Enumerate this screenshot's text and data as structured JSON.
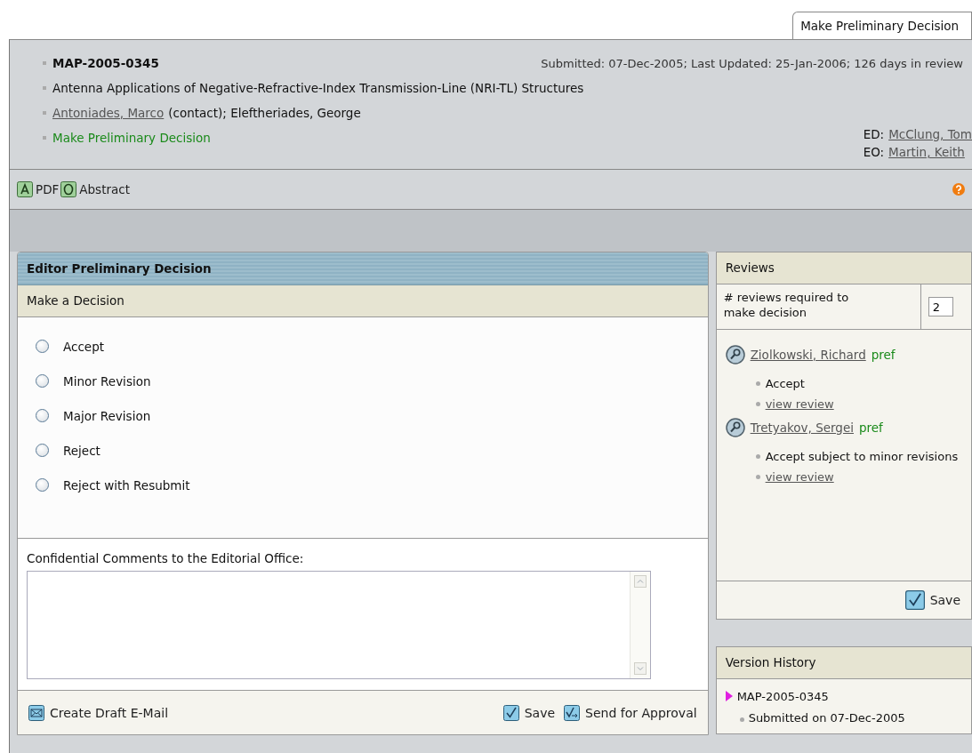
{
  "tab": {
    "label": "Make Preliminary Decision",
    "selected": true
  },
  "header": {
    "manuscript_id": "MAP-2005-0345",
    "dates": "Submitted: 07-Dec-2005; Last Updated: 25-Jan-2006; 126 days in review",
    "title": "Antenna Applications of Negative-Refractive-Index Transmission-Line (NRI-TL) Structures",
    "contact_author": "Antoniades, Marco",
    "authors_rest": "(contact); Eleftheriades, George",
    "stage": "Make Preliminary Decision",
    "staff": [
      {
        "role": "ED:",
        "name": "McClung, Tom"
      },
      {
        "role": "EO:",
        "name": "Martin, Keith"
      }
    ]
  },
  "toolbar": {
    "items": [
      {
        "kind": "pdf",
        "label": "PDF"
      },
      {
        "kind": "abstract",
        "label": "Abstract"
      }
    ]
  },
  "decision_panel": {
    "title": "Editor Preliminary Decision",
    "subtitle": "Make a Decision",
    "options": [
      {
        "label": "Accept",
        "selected": false
      },
      {
        "label": "Minor Revision",
        "selected": false
      },
      {
        "label": "Major Revision",
        "selected": false
      },
      {
        "label": "Reject",
        "selected": false
      },
      {
        "label": "Reject with Resubmit",
        "selected": false
      }
    ],
    "comments_label": "Confidential Comments to the Editorial Office:",
    "actions": [
      {
        "kind": "email",
        "label": "Create Draft E-Mail"
      },
      {
        "kind": "save",
        "label": "Save"
      },
      {
        "kind": "approve",
        "label": "Send for Approval"
      }
    ]
  },
  "reviews": {
    "title": "Reviews",
    "required_label": "# reviews required to make decision",
    "required_value": "2",
    "reviewers": [
      {
        "name": "Ziolkowski, Richard",
        "tag": "pref",
        "items": [
          {
            "kind": "text",
            "label": "Accept"
          },
          {
            "kind": "link",
            "label": "view review"
          }
        ]
      },
      {
        "name": "Tretyakov, Sergei",
        "tag": "pref",
        "items": [
          {
            "kind": "text",
            "label": "Accept subject to minor revisions"
          },
          {
            "kind": "link",
            "label": "view review"
          }
        ]
      }
    ],
    "save": "Save"
  },
  "version_history": {
    "title": "Version History",
    "versions": [
      {
        "id": "MAP-2005-0345",
        "events": [
          "Submitted on 07-Dec-2005"
        ]
      }
    ]
  }
}
